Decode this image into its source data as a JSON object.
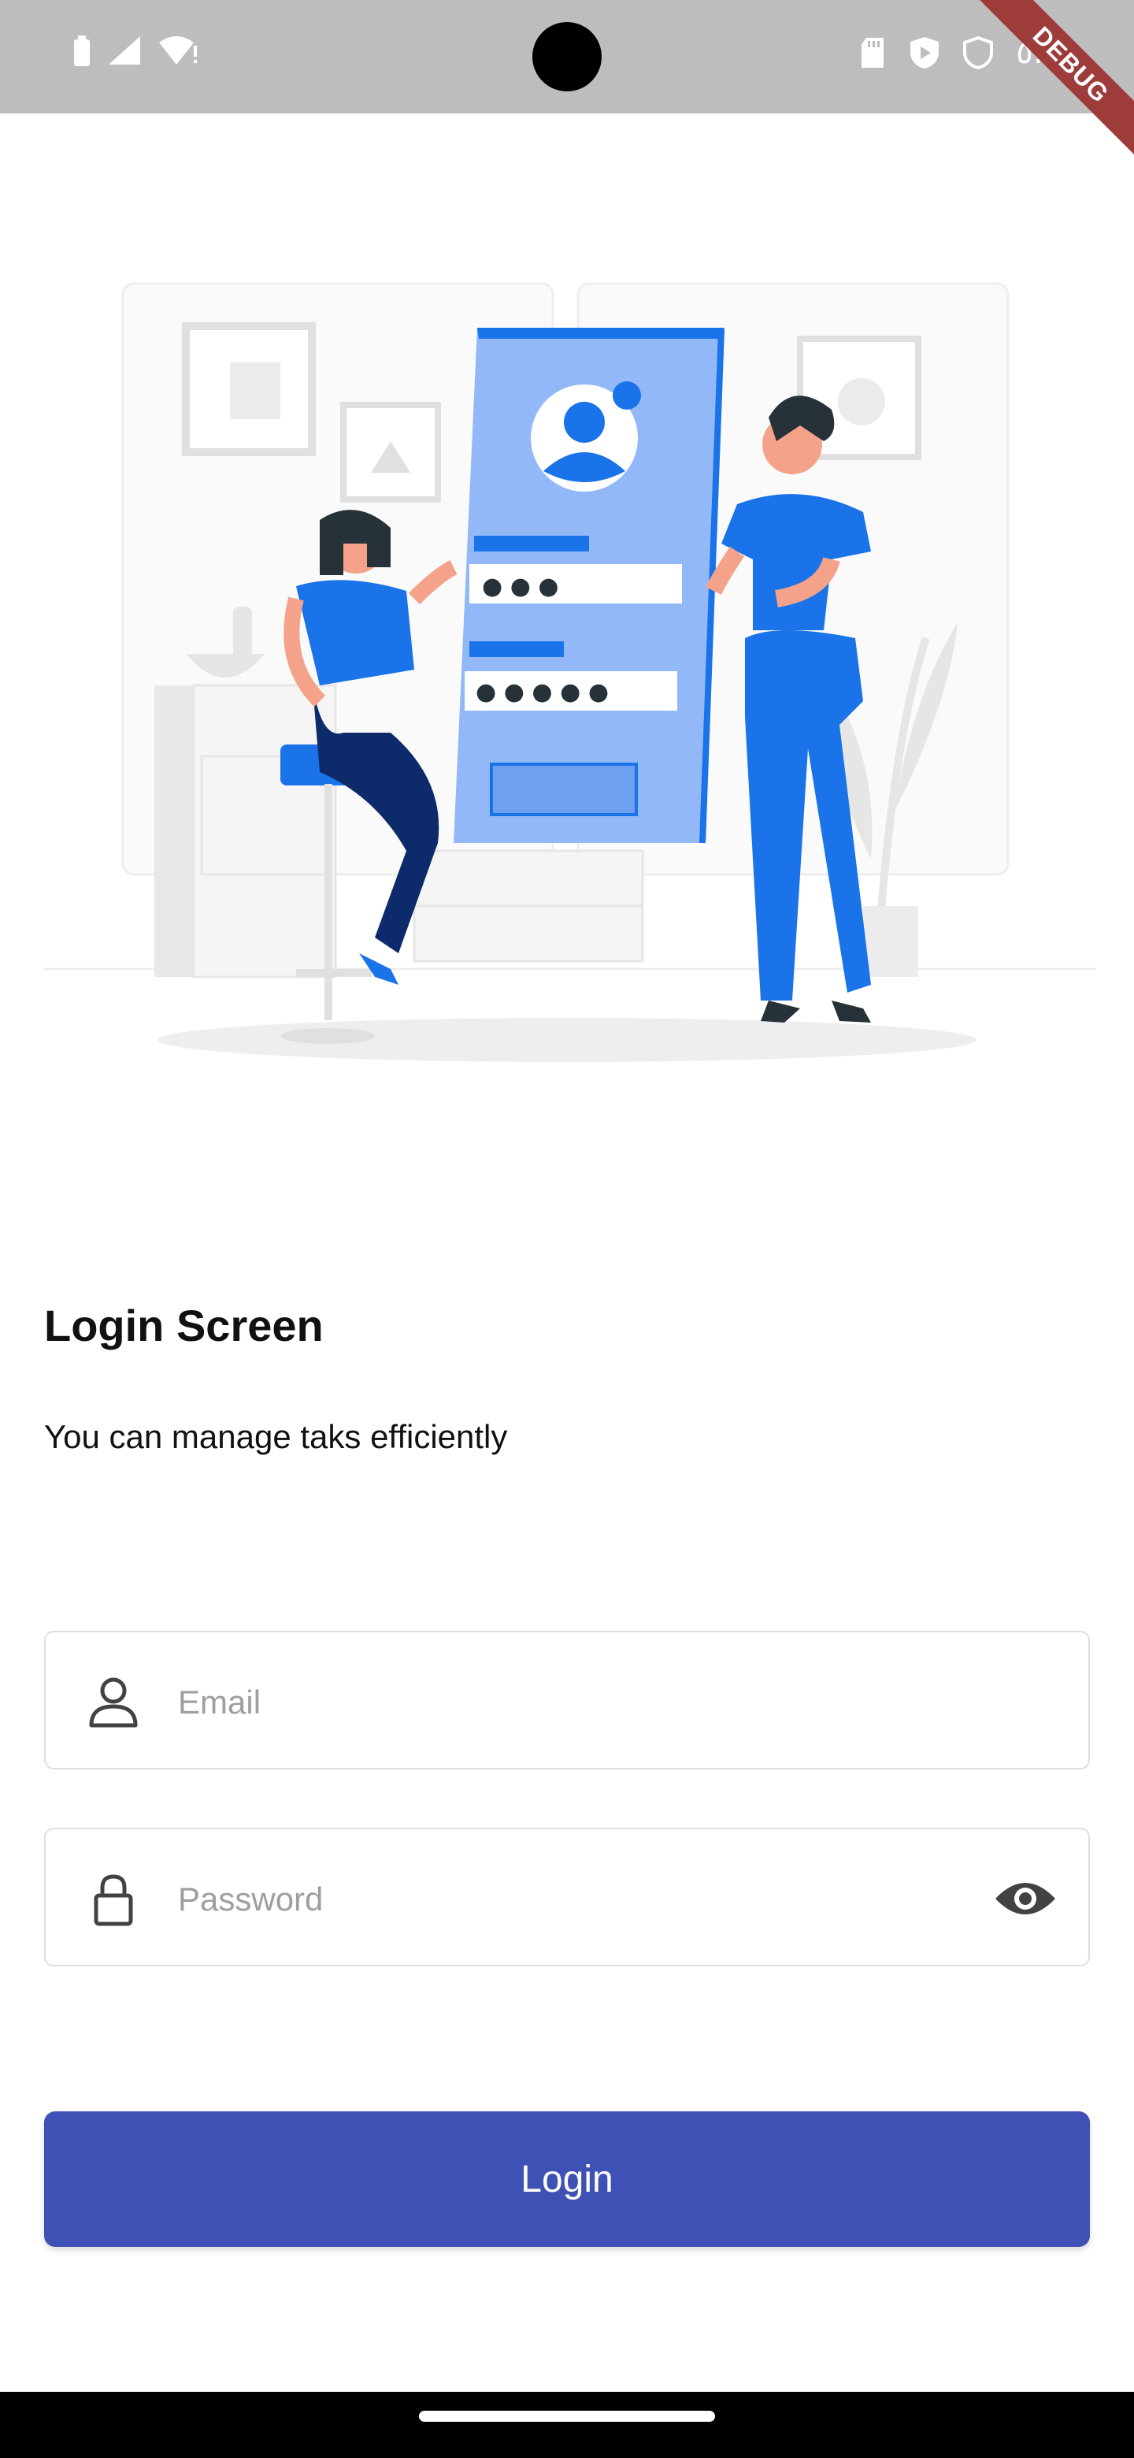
{
  "status_bar": {
    "time": "٥:٣٣",
    "debug_label": "DEBUG",
    "icons": [
      "battery-icon",
      "signal-icon",
      "wifi-icon",
      "sd-card-icon",
      "play-icon",
      "shield-icon"
    ]
  },
  "illustration": {
    "icon": "login-illustration",
    "password_dots_short": "● ● ●",
    "password_dots_long": "● ● ● ● ●"
  },
  "header": {
    "title": "Login Screen",
    "subtitle": "You can manage taks efficiently"
  },
  "form": {
    "email": {
      "placeholder": "Email",
      "value": "",
      "icon": "person-icon"
    },
    "password": {
      "placeholder": "Password",
      "value": "",
      "icon": "lock-icon",
      "toggle_icon": "eye-icon"
    },
    "login_label": "Login"
  },
  "colors": {
    "primary": "#3f51b5",
    "illustration_blue": "#1a73e8",
    "status_bar": "#bdbdbd"
  }
}
